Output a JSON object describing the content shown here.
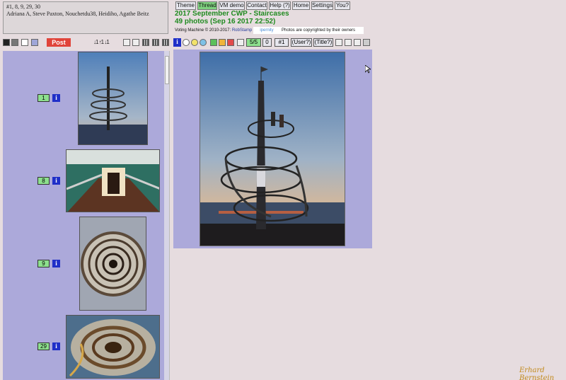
{
  "notes": {
    "line1": "#1, 8, 9, 29, 30",
    "line2": "Adriana A, Steve Paxton, Nouchetdu38, Heidiho, Agathe Beitz"
  },
  "left_toolbar": {
    "post_label": "Post",
    "sort_glyphs": "↓1 ↑1 ↓1"
  },
  "nav": {
    "items": [
      "Theme",
      "Thread",
      "VM demo",
      "Contact",
      "Help (?)",
      "Home",
      "Settings",
      "You?"
    ],
    "active": "Thread"
  },
  "header": {
    "title": "2017 September CWP - Staircases",
    "subtitle": "49 photos (Sep 16 2017 22:52)",
    "credit_text": "Voting Machine © 2010-2017:",
    "credit_link": "RobStamp",
    "ipernity": "ipernity",
    "copyright": "Photos are copyrighted by their owners"
  },
  "viewer_toolbar": {
    "info_label": "i",
    "score": "5/5",
    "zero": "0",
    "rank": "#1",
    "user_button": "(User?)",
    "title_button": "(Title?)"
  },
  "photos": [
    {
      "number": "1",
      "info": "i"
    },
    {
      "number": "8",
      "info": "i"
    },
    {
      "number": "9",
      "info": "i"
    },
    {
      "number": "29",
      "info": "i"
    }
  ],
  "signature": "Erhard Bernstein",
  "colors": {
    "panel": "#aca9da",
    "background": "#e6dcdf",
    "number_green": "#8de08d",
    "info_blue": "#1f2fc8",
    "title_green": "#1f8a1f",
    "post_red": "#e0443a"
  }
}
